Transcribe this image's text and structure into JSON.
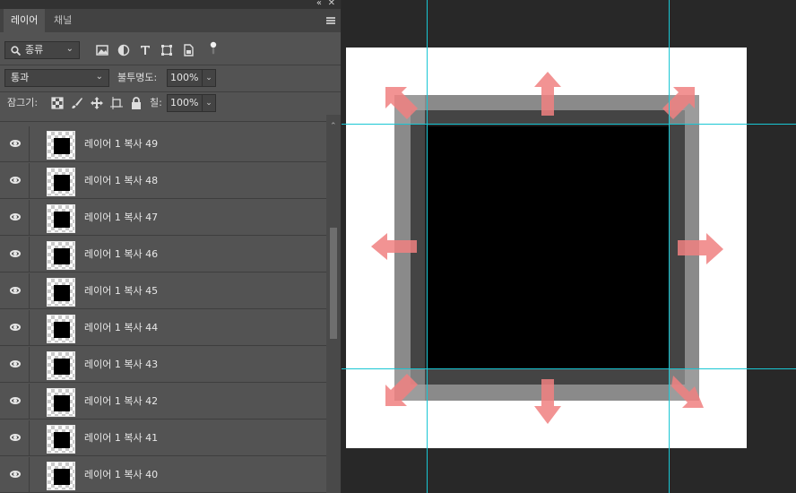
{
  "panel": {
    "collapse_icon": "double-chevron-left-icon",
    "close_icon": "close-icon",
    "tabs": [
      {
        "label": "레이어",
        "active": true
      },
      {
        "label": "채널",
        "active": false
      }
    ],
    "filter": {
      "kind_label": "종류",
      "icons": [
        "image-filter-icon",
        "adjustment-filter-icon",
        "text-filter-icon",
        "shape-filter-icon",
        "smart-object-filter-icon",
        "filter-toggle-icon"
      ]
    },
    "blend": {
      "mode": "통과",
      "opacity_label": "불투명도:",
      "opacity_value": "100%"
    },
    "lock": {
      "label": "잠그기:",
      "icons": [
        "lock-transparent-icon",
        "lock-image-icon",
        "lock-position-icon",
        "lock-artboard-icon",
        "lock-all-icon"
      ],
      "fill_label": "칠:",
      "fill_value": "100%"
    },
    "layers": [
      {
        "name": "레이어 1 복사 49",
        "visible": true
      },
      {
        "name": "레이어 1 복사 48",
        "visible": true
      },
      {
        "name": "레이어 1 복사 47",
        "visible": true
      },
      {
        "name": "레이어 1 복사 46",
        "visible": true
      },
      {
        "name": "레이어 1 복사 45",
        "visible": true
      },
      {
        "name": "레이어 1 복사 44",
        "visible": true
      },
      {
        "name": "레이어 1 복사 43",
        "visible": true
      },
      {
        "name": "레이어 1 복사 42",
        "visible": true
      },
      {
        "name": "레이어 1 복사 41",
        "visible": true
      },
      {
        "name": "레이어 1 복사 40",
        "visible": true
      }
    ]
  },
  "colors": {
    "panel_bg": "#535353",
    "workspace_bg": "#282828",
    "guide": "#19c6d4",
    "arrow": "#f08080"
  }
}
